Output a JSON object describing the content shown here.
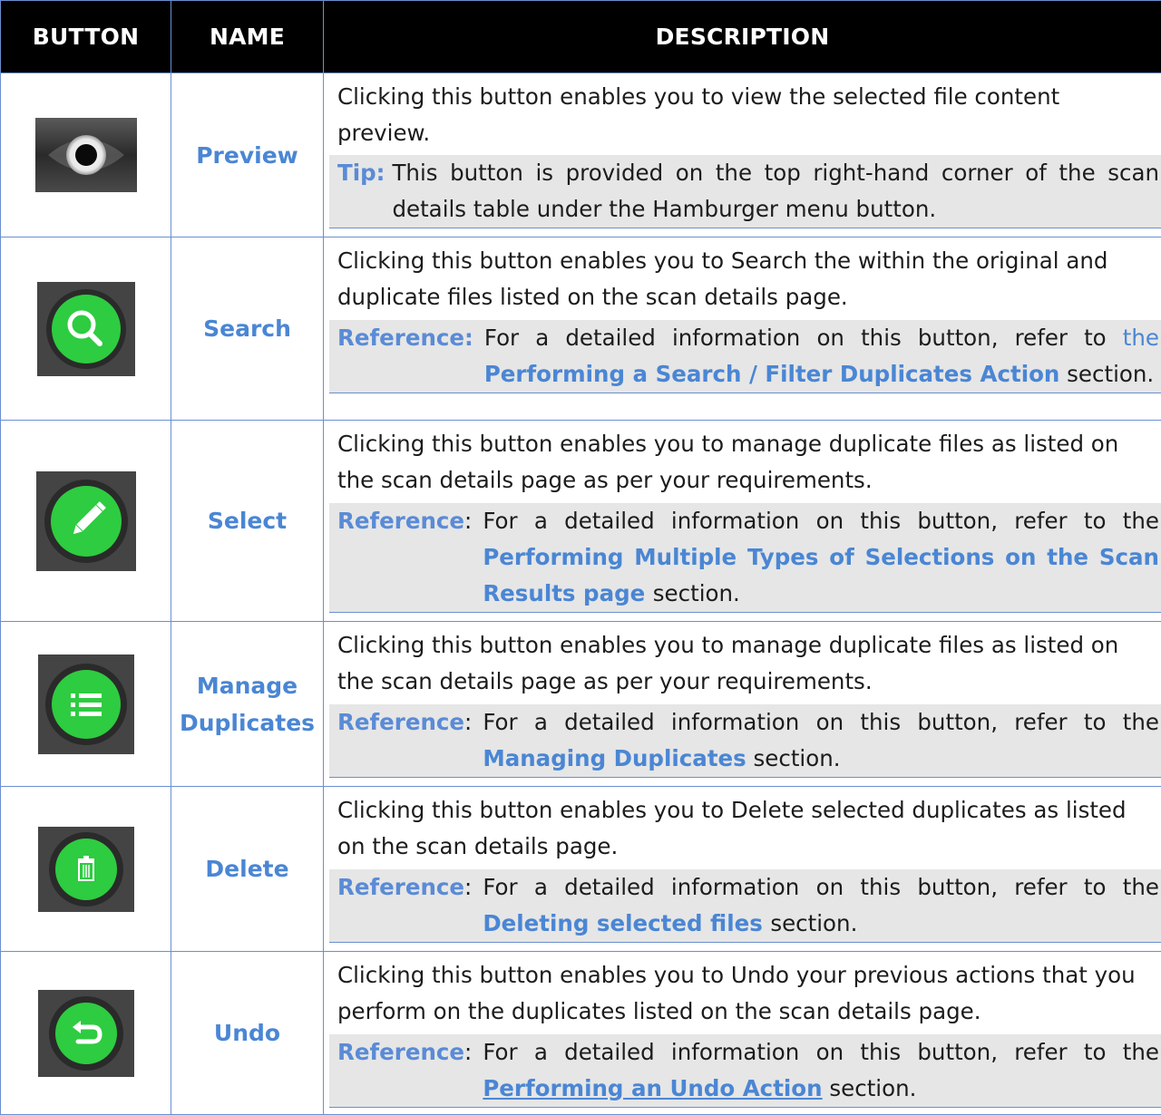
{
  "header": {
    "button": "BUTTON",
    "name": "NAME",
    "description": "DESCRIPTION"
  },
  "rows": [
    {
      "icon": "preview-eye-icon",
      "name_line1": "Preview",
      "name_line2": "",
      "description": "Clicking this button enables you to view the selected file content preview.",
      "note_label": "Tip:",
      "note_text": "This button is provided on the top right-hand corner of the scan details table under the Hamburger menu button.",
      "link_prefix": "",
      "link": "",
      "link_suffix": ""
    },
    {
      "icon": "search-magnifier-icon",
      "name_line1": "Search",
      "name_line2": "",
      "description": "Clicking this button enables you to Search the within the original and duplicate files listed on the scan details page.",
      "note_label": "Reference:",
      "note_text": "For a detailed information on this button, refer to ",
      "link_prefix": "the",
      "link": "Performing a Search / Filter Duplicates Action",
      "link_suffix": " section."
    },
    {
      "icon": "select-pencil-icon",
      "name_line1": "Select",
      "name_line2": "",
      "description": "Clicking this button enables you to manage duplicate files as listed on the scan details page as per your requirements.",
      "note_label": "Reference",
      "note_text": "For a detailed information on this button, refer to the ",
      "link_prefix": "",
      "link": "Performing Multiple Types of Selections on the Scan Results page ",
      "link_suffix": "section."
    },
    {
      "icon": "manage-list-icon",
      "name_line1": "Manage",
      "name_line2": "Duplicates",
      "description": "Clicking this button enables you to manage duplicate files as listed on the scan details page as per your requirements.",
      "note_label": "Reference",
      "note_text": "For a detailed information on this button, refer to the ",
      "link_prefix": "",
      "link": "Managing Duplicates",
      "link_suffix": " section."
    },
    {
      "icon": "delete-trash-icon",
      "name_line1": "Delete",
      "name_line2": "",
      "description": "Clicking this button enables you to Delete selected duplicates as listed on the scan details page.",
      "note_label": "Reference",
      "note_text": "For a detailed information on this button, refer to the ",
      "link_prefix": "",
      "link": "Deleting selected files ",
      "link_suffix": "section."
    },
    {
      "icon": "undo-arrow-icon",
      "name_line1": "Undo",
      "name_line2": "",
      "description": "Clicking this button enables you to Undo your previous actions that you perform on the duplicates listed on the scan details page.",
      "note_label": "Reference",
      "note_text": "For a detailed information on this button, refer to the ",
      "link_prefix": "",
      "link": "Performing an Undo Action",
      "link_suffix": " section."
    }
  ],
  "colors": {
    "header_bg": "#000000",
    "header_text": "#ffffff",
    "accent_blue": "#4a86d4",
    "border_blue": "#6a8fd0",
    "note_bg": "#e6e6e6",
    "icon_green": "#2ecc40",
    "icon_bg": "#3b3b3b"
  }
}
